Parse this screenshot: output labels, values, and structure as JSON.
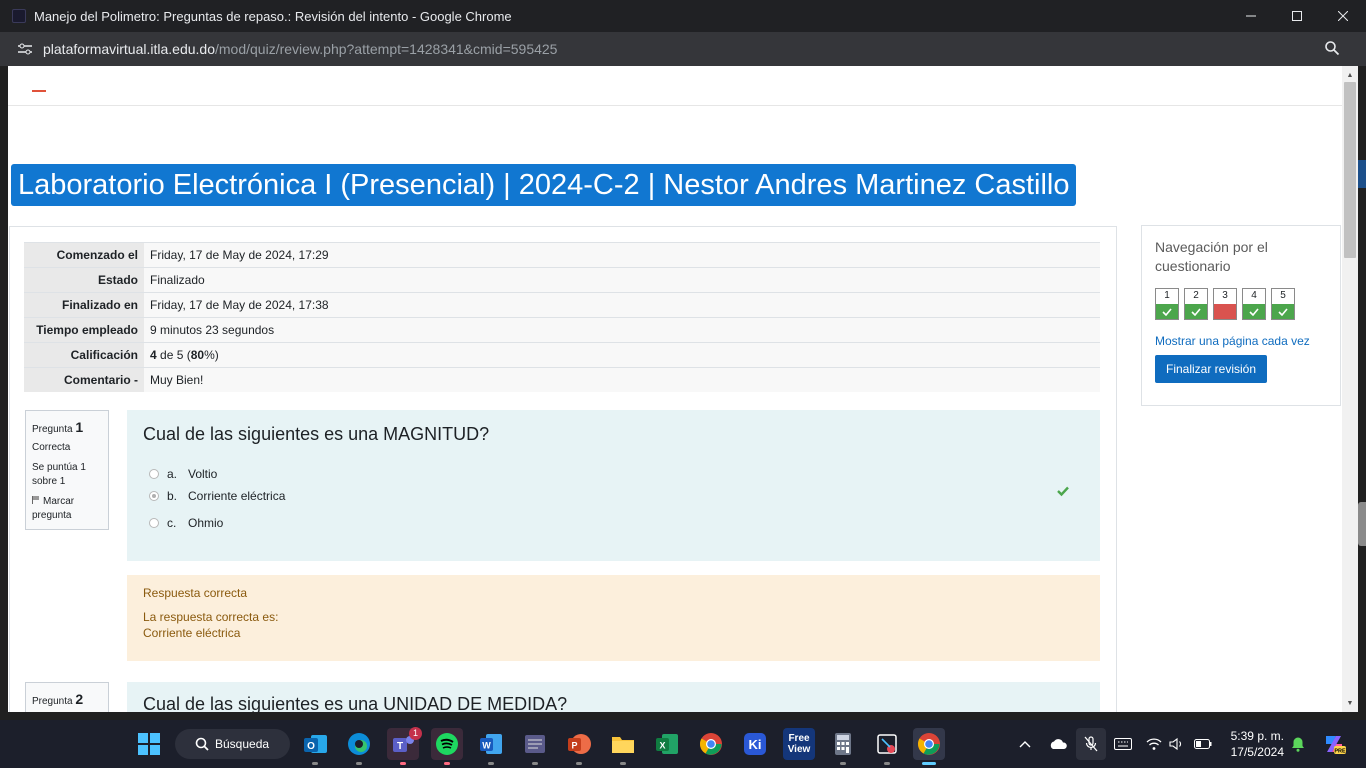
{
  "window": {
    "title": "Manejo del Polimetro: Preguntas de repaso.: Revisión del intento - Google Chrome"
  },
  "address": {
    "host": "plataformavirtual.itla.edu.do",
    "path": "/mod/quiz/review.php?attempt=1428341&cmid=595425"
  },
  "course": {
    "title": "Laboratorio Electrónica I (Presencial) | 2024-C-2 | Nestor Andres Martinez Castillo"
  },
  "summary": {
    "rows": [
      {
        "label": "Comenzado el",
        "value": "Friday, 17 de May de 2024, 17:29"
      },
      {
        "label": "Estado",
        "value": "Finalizado"
      },
      {
        "label": "Finalizado en",
        "value": "Friday, 17 de May de 2024, 17:38"
      },
      {
        "label": "Tiempo empleado",
        "value": "9 minutos 23 segundos"
      },
      {
        "label": "Calificación",
        "score": "4",
        "of_text": " de 5 (",
        "percent": "80",
        "percent_tail": "%)"
      },
      {
        "label": "Comentario -",
        "value": "Muy Bien!"
      }
    ]
  },
  "question1": {
    "prefix": "Pregunta",
    "number": "1",
    "status": "Correcta",
    "score": "Se puntúa 1 sobre 1",
    "flag_label": "Marcar pregunta",
    "text": "Cual de las siguientes es una MAGNITUD?",
    "answers": [
      {
        "letter": "a.",
        "text": "Voltio",
        "selected": false
      },
      {
        "letter": "b.",
        "text": "Corriente eléctrica",
        "selected": true
      },
      {
        "letter": "c.",
        "text": "Ohmio",
        "selected": false
      }
    ],
    "feedback": {
      "result": "Respuesta correcta",
      "correct_intro": "La respuesta correcta es:",
      "correct_answer": "Corriente eléctrica"
    }
  },
  "question2": {
    "prefix": "Pregunta",
    "number": "2",
    "text": "Cual de las siguientes es una UNIDAD DE MEDIDA?"
  },
  "quiz_nav": {
    "title": "Navegación por el cuestionario",
    "buttons": [
      {
        "label": "1",
        "state": "correct"
      },
      {
        "label": "2",
        "state": "correct"
      },
      {
        "label": "3",
        "state": "incorrect"
      },
      {
        "label": "4",
        "state": "correct"
      },
      {
        "label": "5",
        "state": "correct"
      }
    ],
    "show_one_page": "Mostrar una página cada vez",
    "finish_review": "Finalizar revisión"
  },
  "taskbar": {
    "search_label": "Búsqueda",
    "teams_badge": "1",
    "freeview_label_1": "Free",
    "freeview_label_2": "View",
    "time": "5:39 p. m.",
    "date": "17/5/2024"
  },
  "colors": {
    "accent": "#1177d1",
    "correct": "#4ca64c",
    "incorrect": "#d9534f",
    "feedback_bg": "#fcefdc",
    "question_bg": "#e7f3f5"
  }
}
